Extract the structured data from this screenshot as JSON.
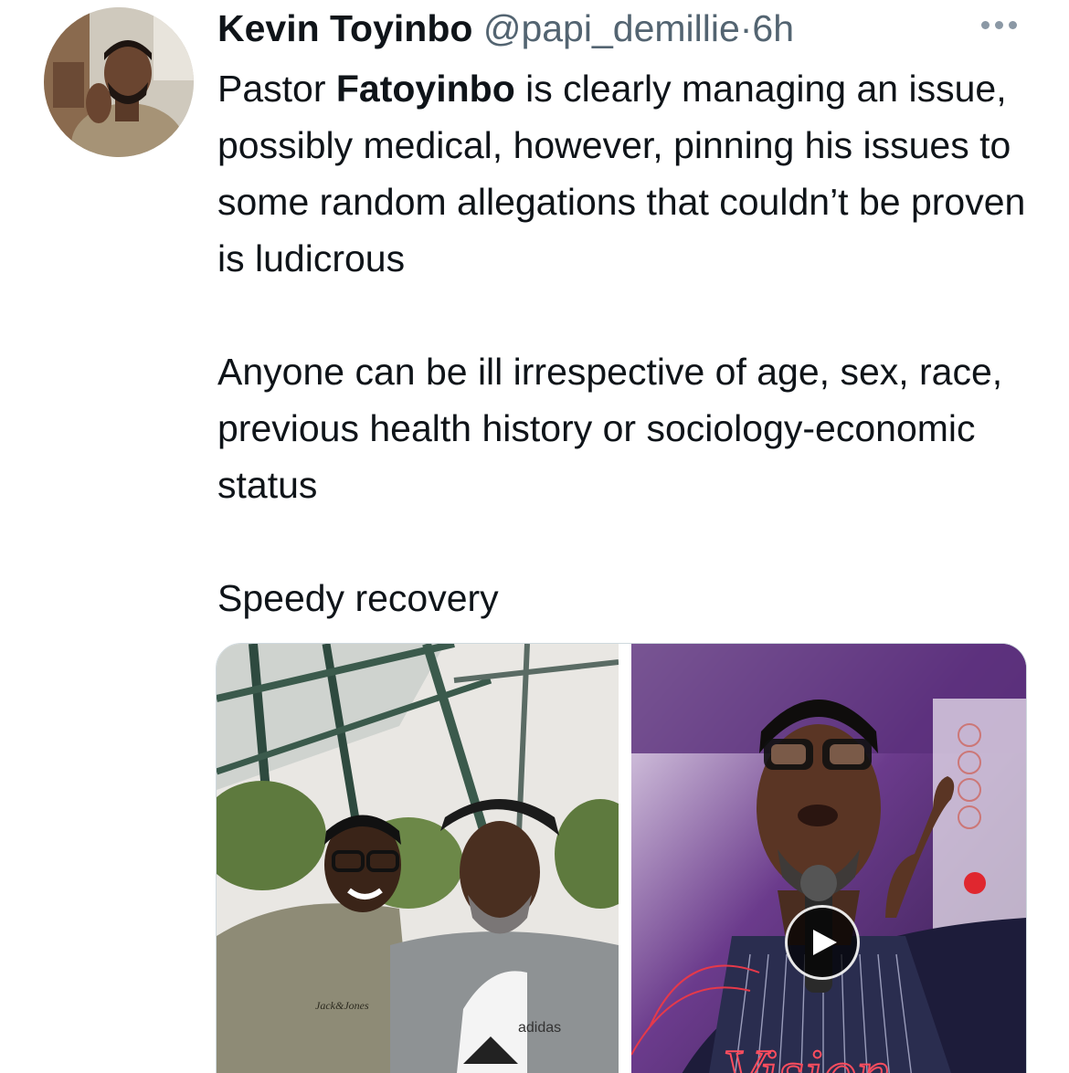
{
  "tweet": {
    "author_name": "Kevin Toyinbo",
    "handle": "@papi_demillie",
    "separator": "·",
    "time": "6h",
    "more_icon": "ellipsis-icon",
    "text": {
      "p1_before": "Pastor ",
      "p1_bold": "Fatoyinbo",
      "p1_after": " is clearly managing an issue, possibly medical, however, pinning his issues to some random allegations that couldn’t be proven is ludicrous",
      "p2": "Anyone can be ill irrespective of age, sex, race, previous health history or sociology-economic status",
      "p3": "Speedy recovery"
    },
    "media": {
      "photo_1_label": "adidas",
      "photo_1_hoodie_label": "Jack&Jones",
      "photo_2_label": "Vision",
      "play_icon": "play-icon"
    }
  },
  "colors": {
    "text_primary": "#0f1419",
    "text_secondary": "#536471",
    "border": "#cfd9de"
  }
}
